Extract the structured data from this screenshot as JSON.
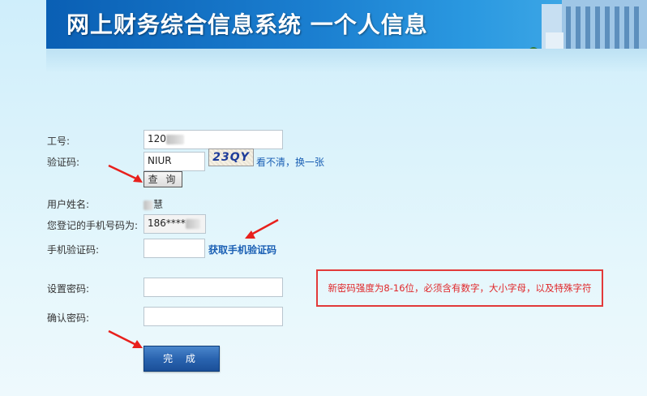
{
  "header": {
    "title": "网上财务综合信息系统 一个人信息"
  },
  "form": {
    "employee_id": {
      "label": "工号:",
      "value": "120"
    },
    "captcha": {
      "label": "验证码:",
      "value": "NIUR",
      "image_text": "23QY",
      "refresh_link": "看不清，换一张"
    },
    "query_button": "查 询",
    "user_name": {
      "label": "用户姓名:",
      "value": "慧"
    },
    "phone": {
      "label": "您登记的手机号码为:",
      "value": "186****"
    },
    "sms_code": {
      "label": "手机验证码:",
      "value": "",
      "get_link": "获取手机验证码"
    },
    "set_password": {
      "label": "设置密码:",
      "value": ""
    },
    "confirm_password": {
      "label": "确认密码:",
      "value": ""
    },
    "password_rule": "新密码强度为8-16位，必须含有数字，大小字母，以及特殊字符",
    "submit_button": "完 成"
  },
  "colors": {
    "banner_blue": "#1b7fd0",
    "link_blue": "#1a5fb4",
    "notice_red": "#e23a3a",
    "button_blue": "#2a64b0"
  }
}
